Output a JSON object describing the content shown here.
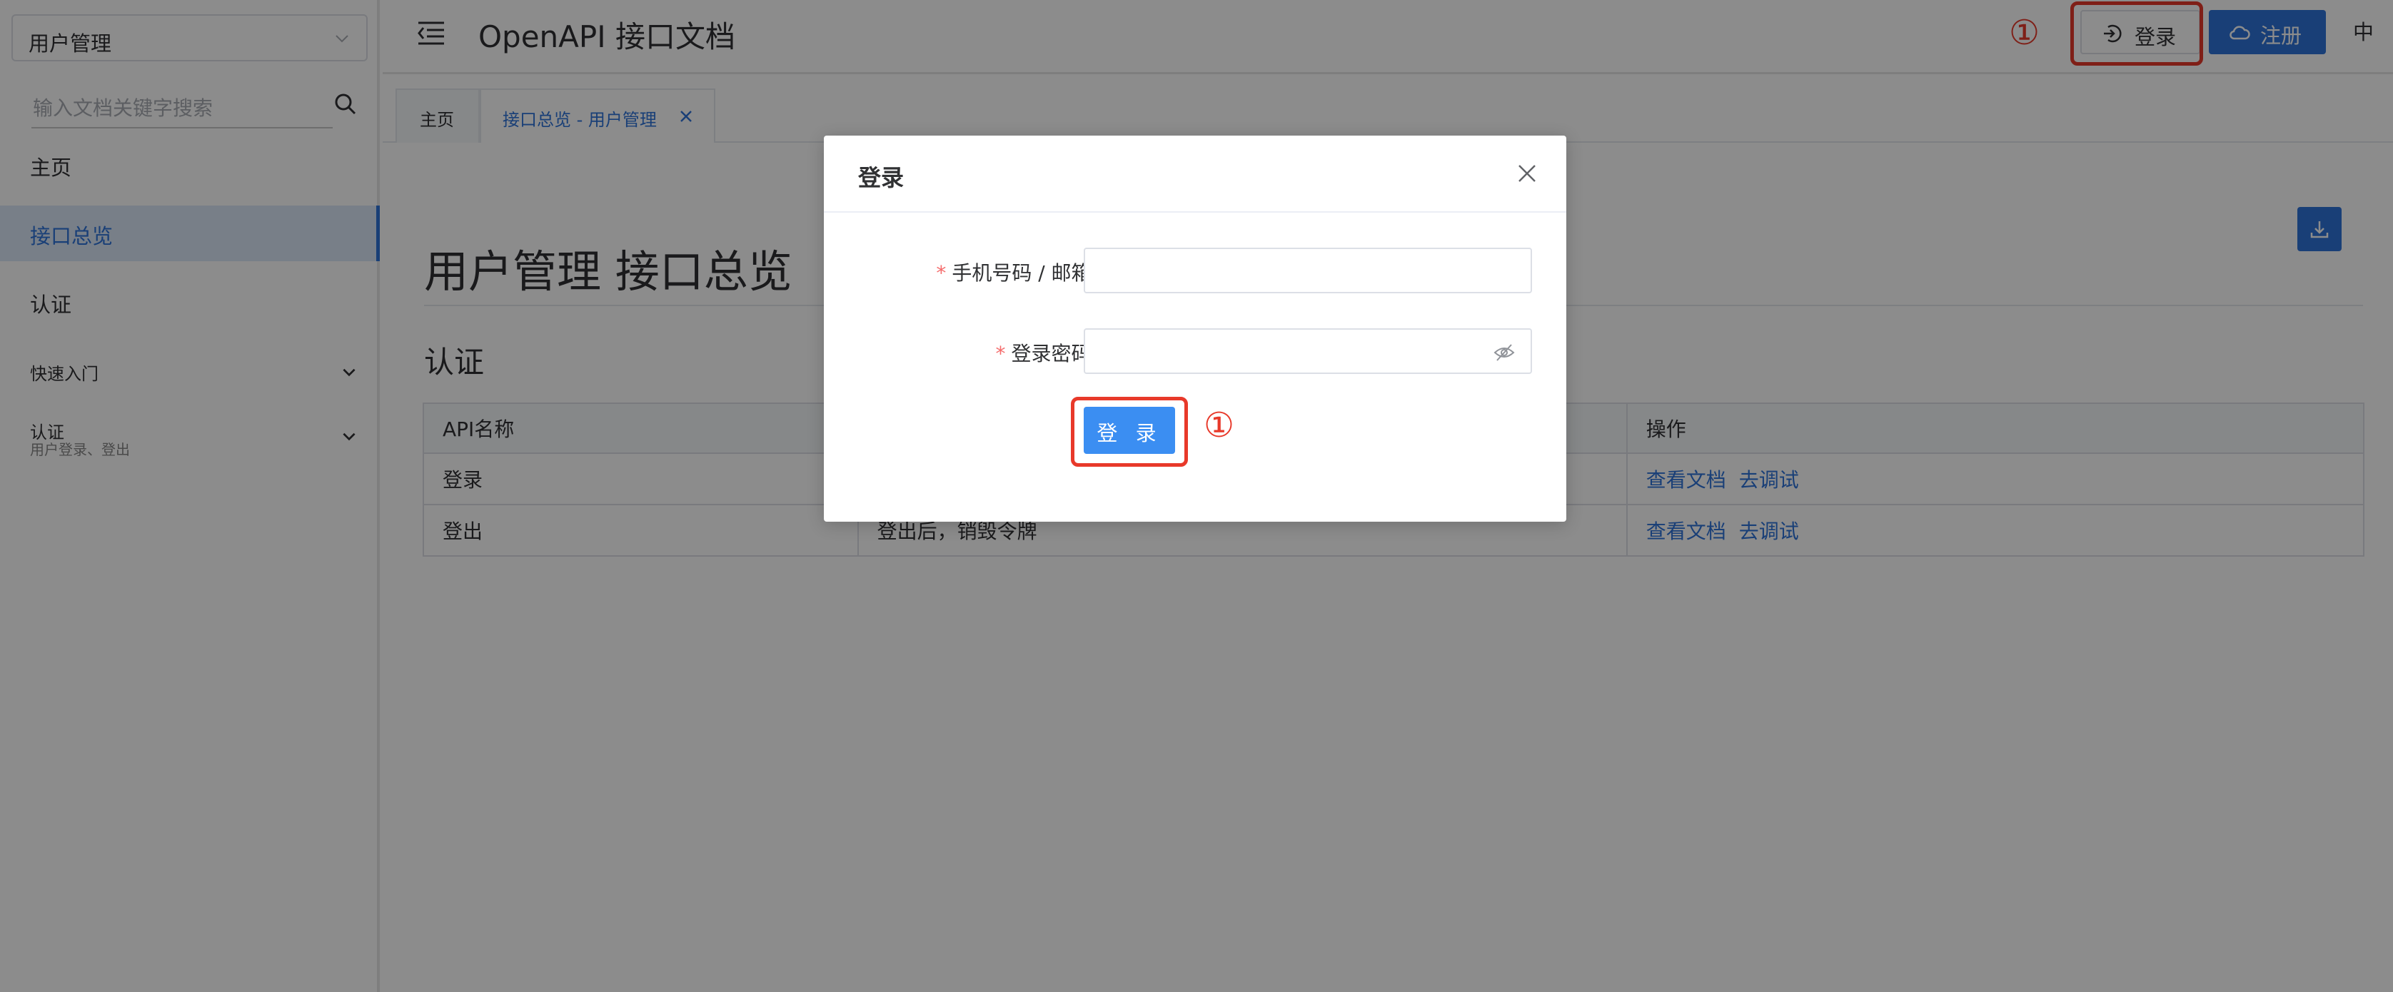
{
  "sidebar": {
    "project_select": "用户管理",
    "search_placeholder": "输入文档关键字搜索",
    "nav": {
      "home": "主页",
      "overview": "接口总览",
      "auth": "认证",
      "quick_start": "快速入门",
      "auth_group": "认证",
      "auth_group_sub": "用户登录、登出"
    }
  },
  "header": {
    "title": "OpenAPI 接口文档",
    "marker": "①",
    "login_label": "登录",
    "signup_label": "注册",
    "lang": "中"
  },
  "tabs": [
    {
      "label": "主页"
    },
    {
      "label": "接口总览 - 用户管理"
    }
  ],
  "main": {
    "page_title": "用户管理 接口总览",
    "section_title": "认证",
    "table": {
      "headers": [
        "API名称",
        "",
        "",
        "操作"
      ],
      "rows": [
        {
          "name": "登录",
          "desc": "",
          "actions": [
            "查看文档",
            "去调试"
          ]
        },
        {
          "name": "登出",
          "desc": "登出后，销毁令牌",
          "actions": [
            "查看文档",
            "去调试"
          ]
        }
      ]
    }
  },
  "modal": {
    "title": "登录",
    "fields": {
      "account_label": "手机号码 / 邮箱",
      "account_value": "",
      "password_label": "登录密码",
      "password_value": "",
      "required_mark": "*",
      "colon": ":"
    },
    "submit_label": "登 录",
    "marker": "①"
  },
  "colors": {
    "primary": "#2f73d9",
    "button": "#3b8ef2",
    "highlight": "#e8392a",
    "required": "#f56c6c"
  }
}
